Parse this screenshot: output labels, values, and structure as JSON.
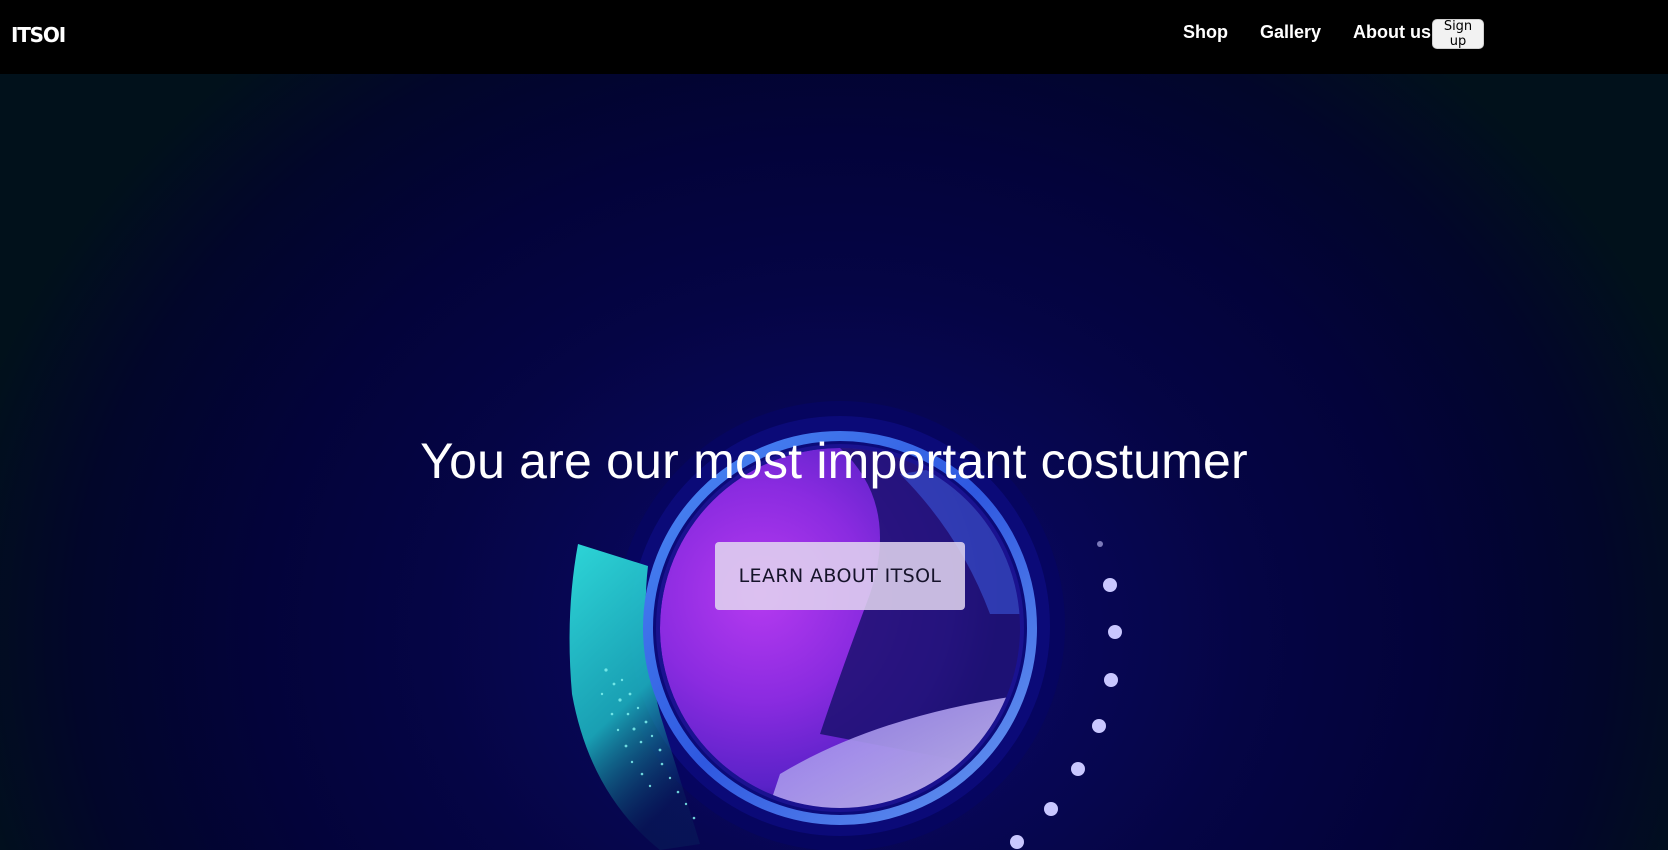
{
  "brand": {
    "logo": "ITSOI"
  },
  "nav": {
    "links": [
      "Shop",
      "Gallery",
      "About us"
    ],
    "signup_label": "Sign up"
  },
  "hero": {
    "title": "You are our most important costumer",
    "cta_label": "LEARN ABOUT ITSOL"
  },
  "colors": {
    "navbar_bg": "#000000",
    "hero_bg": "#050545",
    "orb_purple": "#9b2fe0",
    "ring_blue": "#3a6fe6",
    "accent_teal": "#2cd4d4",
    "cta_bg": "#e2d6f0"
  }
}
